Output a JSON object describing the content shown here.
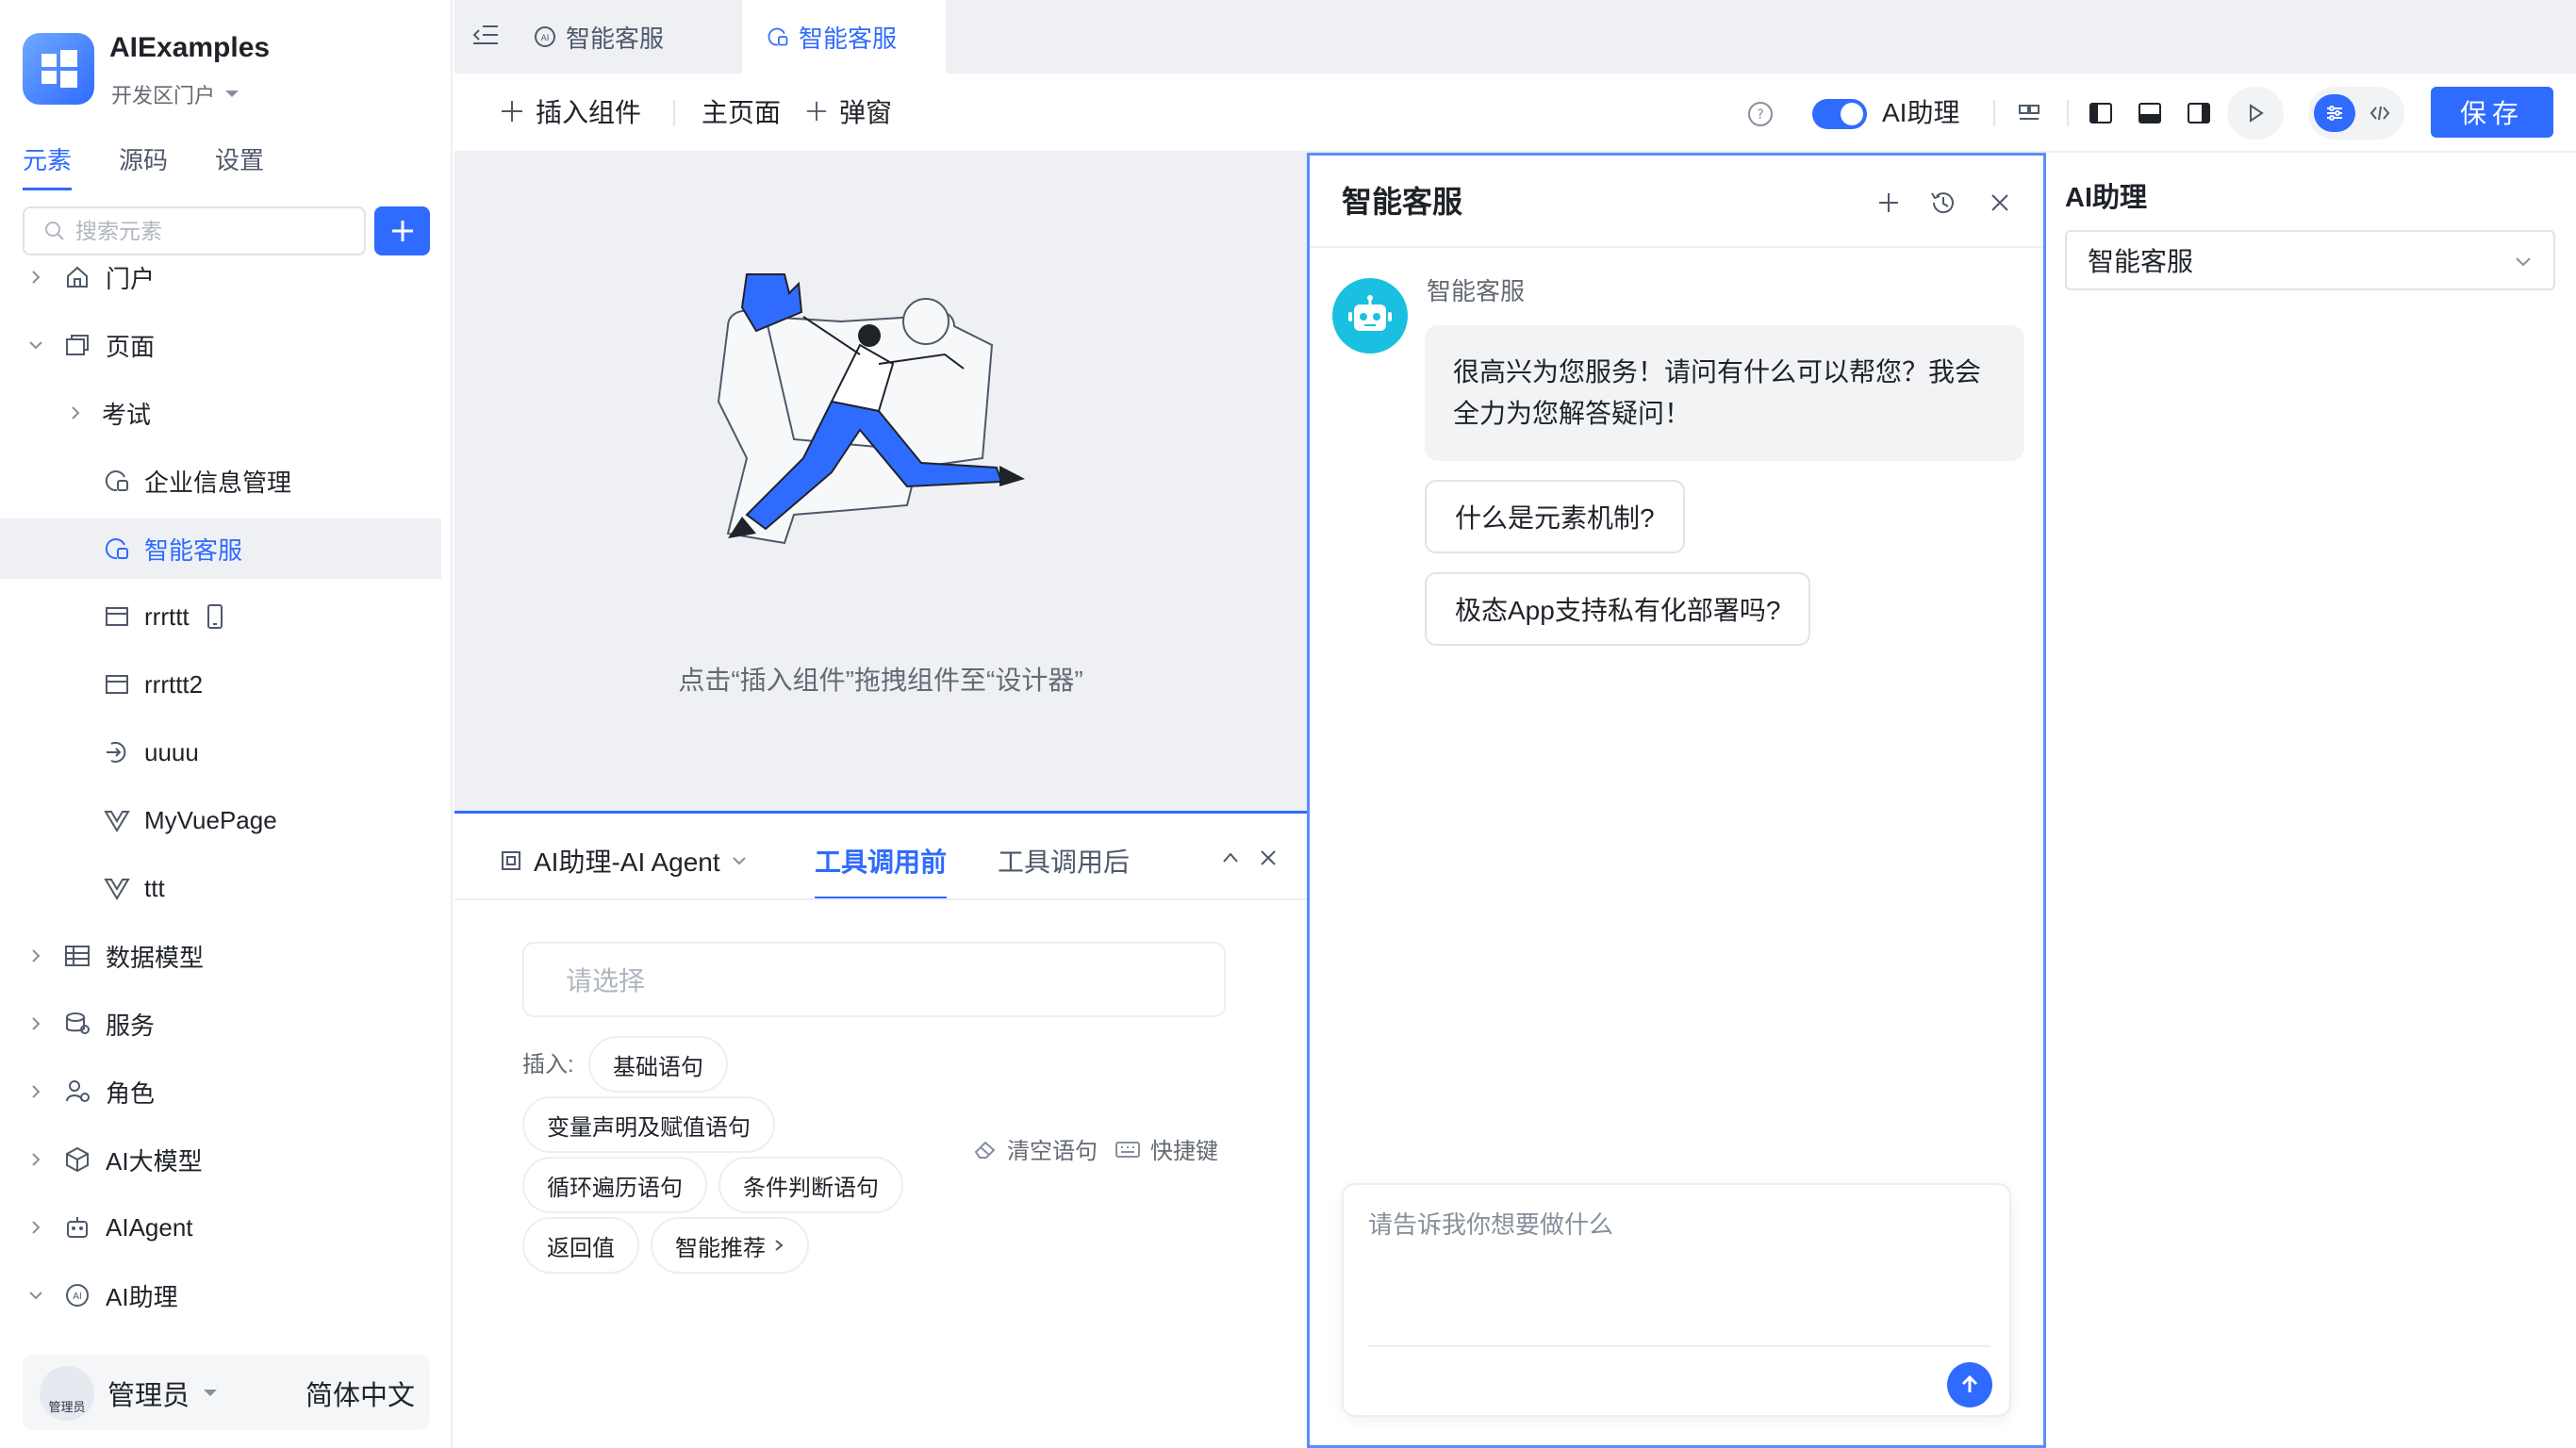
{
  "app": {
    "name": "AIExamples",
    "portal": "开发区门户"
  },
  "sidebar": {
    "tabs": [
      {
        "label": "元素",
        "active": true
      },
      {
        "label": "源码",
        "active": false
      },
      {
        "label": "设置",
        "active": false
      }
    ],
    "search_placeholder": "搜索元素",
    "tree": [
      {
        "label": "门户",
        "icon": "home-icon",
        "expanded": false,
        "level": 0
      },
      {
        "label": "页面",
        "icon": "pages-icon",
        "expanded": true,
        "level": 0
      },
      {
        "label": "考试",
        "icon": "",
        "expanded": false,
        "level": 1
      },
      {
        "label": "企业信息管理",
        "icon": "ai-page-icon",
        "level": 2
      },
      {
        "label": "智能客服",
        "icon": "ai-page-icon",
        "level": 2,
        "selected": true
      },
      {
        "label": "rrrttt",
        "icon": "form-page-icon",
        "level": 2,
        "mobile": true
      },
      {
        "label": "rrrttt2",
        "icon": "form-page-icon",
        "level": 2
      },
      {
        "label": "uuuu",
        "icon": "redirect-page-icon",
        "level": 2
      },
      {
        "label": "MyVuePage",
        "icon": "vue-icon",
        "level": 2
      },
      {
        "label": "ttt",
        "icon": "vue-icon",
        "level": 2
      },
      {
        "label": "数据模型",
        "icon": "table-icon",
        "expanded": false,
        "level": 0
      },
      {
        "label": "服务",
        "icon": "database-icon",
        "expanded": false,
        "level": 0
      },
      {
        "label": "角色",
        "icon": "roles-icon",
        "expanded": false,
        "level": 0
      },
      {
        "label": "AI大模型",
        "icon": "model-cube-icon",
        "expanded": false,
        "level": 0
      },
      {
        "label": "AIAgent",
        "icon": "robot-icon",
        "expanded": false,
        "level": 0
      },
      {
        "label": "AI助理",
        "icon": "ai-badge-icon",
        "expanded": true,
        "level": 0
      }
    ],
    "user": {
      "name": "管理员",
      "avatar_caption": "管理员"
    },
    "language": "简体中文"
  },
  "tabs": [
    {
      "label": "智能客服",
      "icon": "ai-badge-icon",
      "active": false
    },
    {
      "label": "智能客服",
      "icon": "ai-page-icon",
      "active": true
    }
  ],
  "toolbar": {
    "insert_component": "插入组件",
    "main_page": "主页面",
    "popup": "弹窗",
    "ai_assistant_label": "AI助理",
    "ai_assistant_enabled": true,
    "save": "保存"
  },
  "canvas": {
    "empty_hint": "点击“插入组件”拖拽组件至“设计器”"
  },
  "bottom_panel": {
    "agent_select": "AI助理-AI Agent",
    "tabs": [
      {
        "label": "工具调用前",
        "active": true
      },
      {
        "label": "工具调用后",
        "active": false
      }
    ],
    "select_placeholder": "请选择",
    "insert_label": "插入:",
    "chips": [
      "基础语句",
      "变量声明及赋值语句",
      "循环遍历语句",
      "条件判断语句",
      "返回值",
      "智能推荐"
    ],
    "clear_statement": "清空语句",
    "shortcut": "快捷键"
  },
  "chat": {
    "title": "智能客服",
    "bot_name": "智能客服",
    "greeting": "很高兴为您服务！请问有什么可以帮您？我会全力为您解答疑问！",
    "suggestions": [
      "什么是元素机制?",
      "极态App支持私有化部署吗?"
    ],
    "input_placeholder": "请告诉我你想要做什么"
  },
  "props": {
    "title": "AI助理",
    "assistant_value": "智能客服"
  },
  "colors": {
    "accent": "#2f6bff",
    "bot_avatar": "#1bc0e0",
    "canvas_bg": "#eef0f4"
  }
}
